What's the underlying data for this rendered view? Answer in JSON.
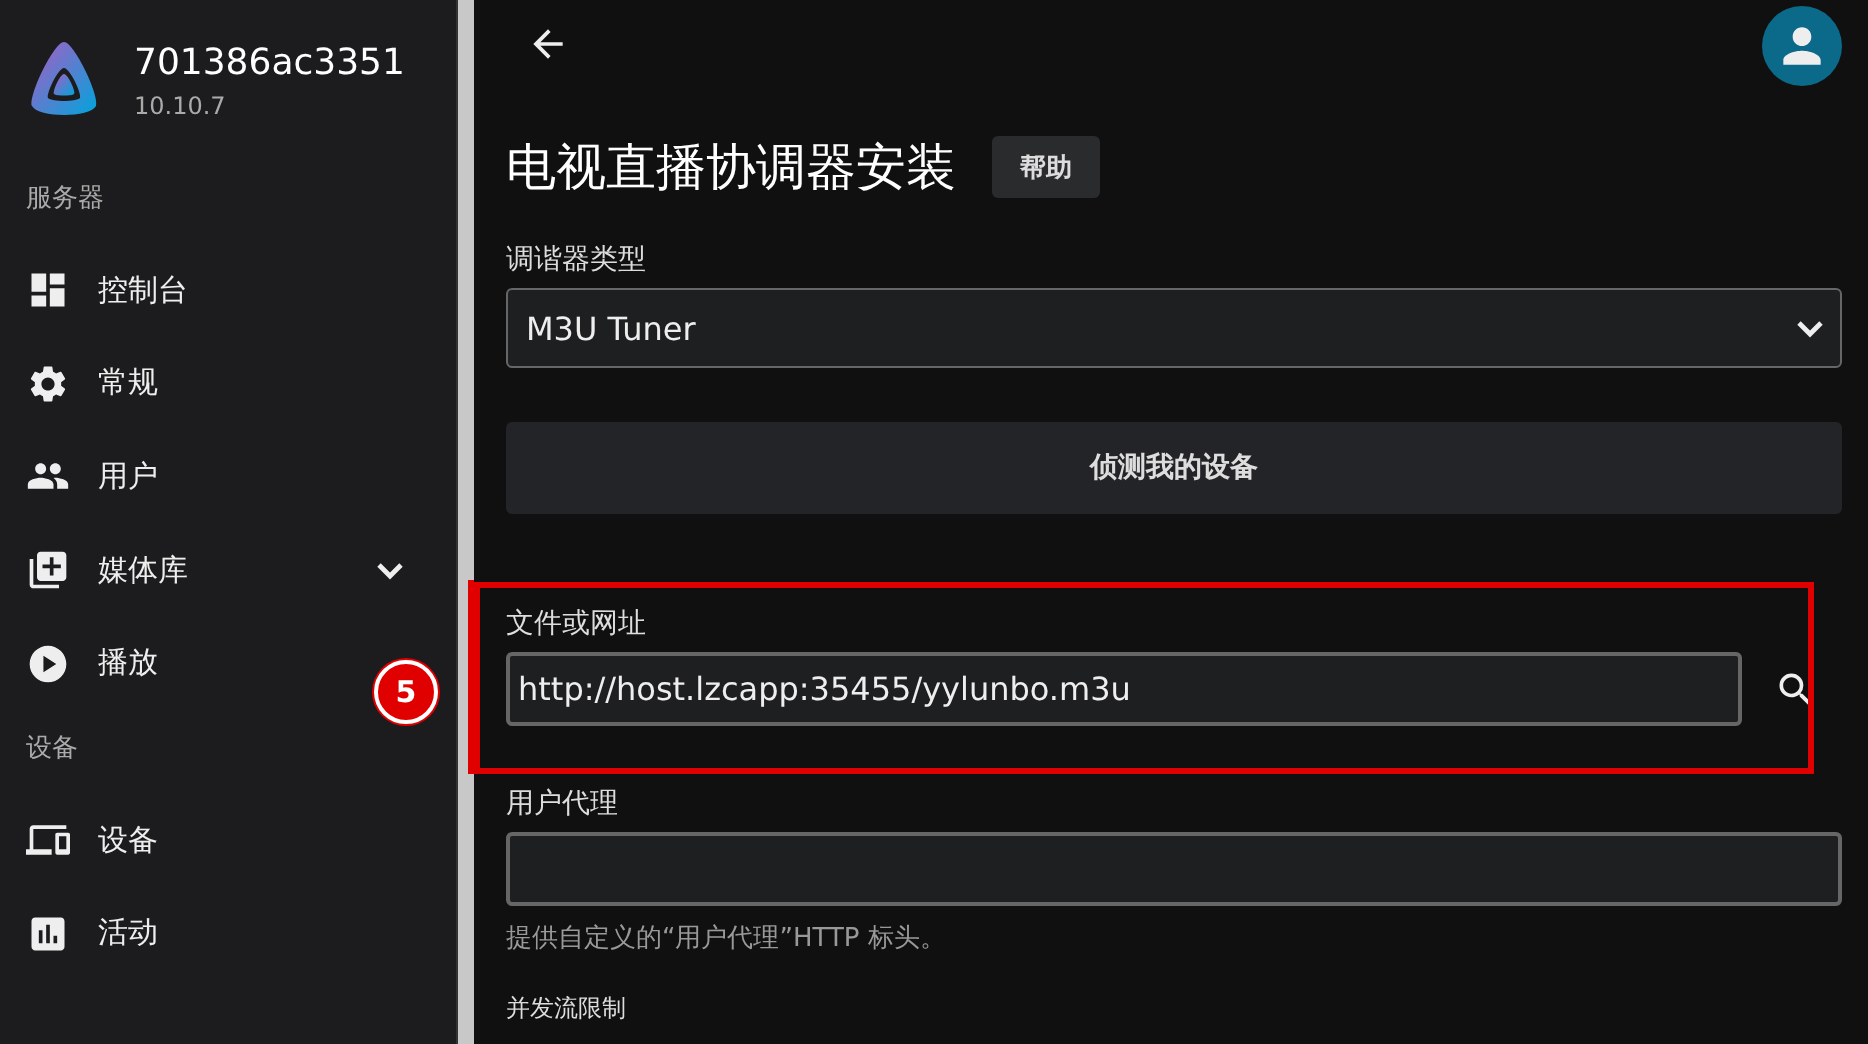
{
  "server": {
    "name": "701386ac3351",
    "version": "10.10.7"
  },
  "sidebar": {
    "sections": [
      {
        "title": "服务器",
        "items": [
          {
            "kind": "dashboard",
            "label": "控制台",
            "expandable": false
          },
          {
            "kind": "general",
            "label": "常规",
            "expandable": false
          },
          {
            "kind": "users",
            "label": "用户",
            "expandable": false
          },
          {
            "kind": "libraries",
            "label": "媒体库",
            "expandable": true
          },
          {
            "kind": "playback",
            "label": "播放",
            "expandable": false
          }
        ]
      },
      {
        "title": "设备",
        "items": [
          {
            "kind": "devices",
            "label": "设备",
            "expandable": false
          },
          {
            "kind": "activity",
            "label": "活动",
            "expandable": false
          }
        ]
      }
    ]
  },
  "annotation": {
    "badge": "5"
  },
  "page": {
    "title": "电视直播协调器安装",
    "help_button": "帮助",
    "tuner_type": {
      "label": "调谐器类型",
      "value": "M3U Tuner"
    },
    "detect_button": "侦测我的设备",
    "file_or_url": {
      "label": "文件或网址",
      "value": "http://host.lzcapp:35455/yylunbo.m3u",
      "highlighted": true
    },
    "user_agent": {
      "label": "用户代理",
      "help": "提供自定义的“用户代理”HTTP 标头。"
    },
    "next_label": "并发流限制"
  }
}
